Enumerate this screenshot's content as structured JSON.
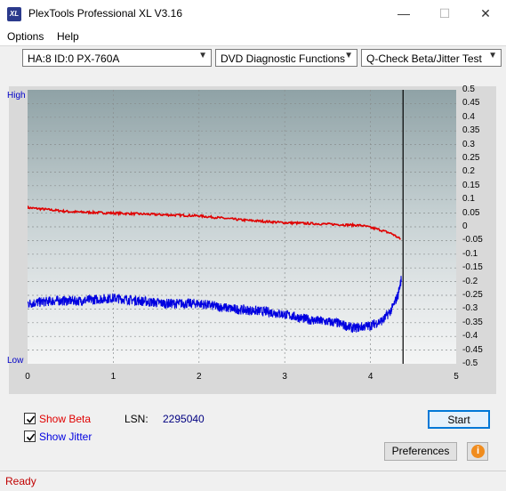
{
  "window": {
    "title": "PlexTools Professional XL V3.16",
    "icon_text": "XL",
    "minimize": "—",
    "maximize": "☐",
    "close": "✕"
  },
  "menu": {
    "options": "Options",
    "help": "Help"
  },
  "toolbar": {
    "drive": "HA:8 ID:0  PX-760A",
    "function": "DVD Diagnostic Functions",
    "test": "Q-Check Beta/Jitter Test"
  },
  "chart_data": {
    "type": "line",
    "left_axis_labels": {
      "high": "High",
      "low": "Low"
    },
    "x_ticks": [
      "0",
      "1",
      "2",
      "3",
      "4",
      "5"
    ],
    "xlim": [
      0,
      5
    ],
    "right_ticks": [
      "0.5",
      "0.45",
      "0.4",
      "0.35",
      "0.3",
      "0.25",
      "0.2",
      "0.15",
      "0.1",
      "0.05",
      "0",
      "-0.05",
      "-0.1",
      "-0.15",
      "-0.2",
      "-0.25",
      "-0.3",
      "-0.35",
      "-0.4",
      "-0.45",
      "-0.5"
    ],
    "ylim": [
      -0.5,
      0.5
    ],
    "cursor_x": 4.38,
    "series": [
      {
        "name": "Beta",
        "color": "#e00000",
        "x": [
          0,
          0.5,
          1.0,
          1.5,
          2.0,
          2.5,
          3.0,
          3.5,
          3.9,
          4.1,
          4.25,
          4.35
        ],
        "y": [
          0.07,
          0.055,
          0.05,
          0.045,
          0.04,
          0.025,
          0.015,
          0.01,
          0.005,
          -0.01,
          -0.025,
          -0.045
        ]
      },
      {
        "name": "Jitter",
        "color": "#0000e0",
        "x": [
          0,
          0.3,
          0.6,
          1.0,
          1.3,
          1.6,
          2.0,
          2.4,
          2.8,
          3.0,
          3.3,
          3.6,
          3.8,
          4.0,
          4.15,
          4.25,
          4.32,
          4.36
        ],
        "y": [
          -0.28,
          -0.27,
          -0.27,
          -0.26,
          -0.27,
          -0.28,
          -0.28,
          -0.3,
          -0.31,
          -0.32,
          -0.34,
          -0.35,
          -0.37,
          -0.36,
          -0.34,
          -0.3,
          -0.25,
          -0.19
        ]
      }
    ]
  },
  "options": {
    "show_beta": "Show Beta",
    "show_jitter": "Show Jitter",
    "lsn_label": "LSN:",
    "lsn_value": "2295040"
  },
  "buttons": {
    "start": "Start",
    "preferences": "Preferences",
    "info": "i"
  },
  "status": {
    "text": "Ready"
  },
  "colors": {
    "beta": "#e00000",
    "jitter": "#0000e0",
    "status": "#c00000"
  }
}
